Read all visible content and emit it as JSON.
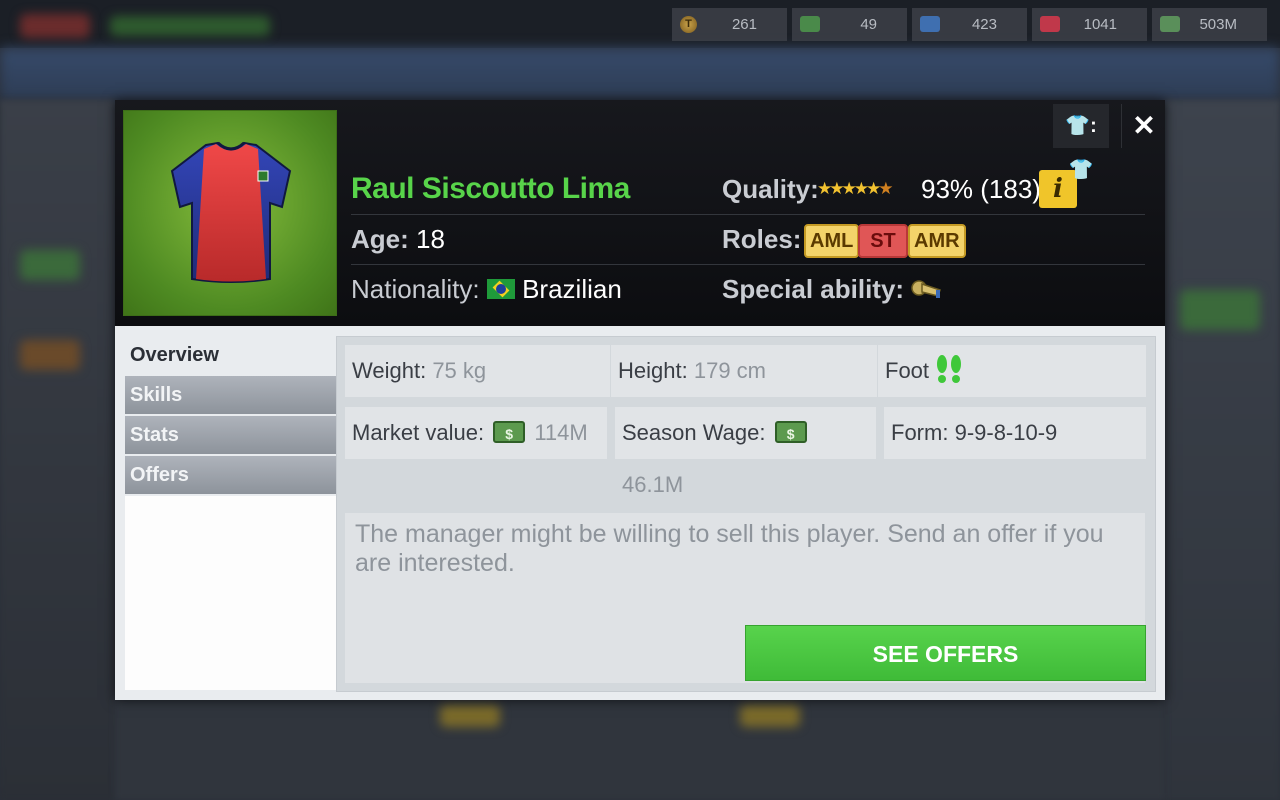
{
  "currencies": [
    {
      "icon": "token-icon",
      "glyph": "T",
      "value": "261"
    },
    {
      "icon": "cash-stack-icon",
      "value": "49"
    },
    {
      "icon": "energy-icon",
      "value": "423"
    },
    {
      "icon": "medical-icon",
      "value": "1041"
    },
    {
      "icon": "money-icon",
      "value": "503M"
    }
  ],
  "header": {
    "switch_label": "👕:👕",
    "close_label": "✕"
  },
  "player": {
    "name": "Raul Siscoutto Lima",
    "age_label": "Age:",
    "age": "18",
    "nationality_label": "Nationality:",
    "nationality": "Brazilian",
    "quality_label": "Quality:",
    "stars": "★★★★★",
    "quality_value": "93% (183)",
    "info_label": "i",
    "roles_label": "Roles:",
    "roles": [
      "AML",
      "ST",
      "AMR"
    ],
    "special_label": "Special ability:"
  },
  "tabs": [
    "Overview",
    "Skills",
    "Stats",
    "Offers"
  ],
  "overview": {
    "weight_label": "Weight:",
    "weight": "75 kg",
    "height_label": "Height:",
    "height": "179 cm",
    "foot_label": "Foot",
    "market_label": "Market value:",
    "market_value": "114M",
    "wage_label": "Season Wage:",
    "wage_value": "46.1M",
    "form_label": "Form:",
    "form_value": "9-9-8-10-9",
    "message": "The manager might be willing to sell this player. Send an offer if you are interested.",
    "button_label": "SEE OFFERS"
  },
  "colors": {
    "name": "#58d44a",
    "button": "#4ac742",
    "info": "#f0c52a",
    "role_yellow": "#f3d36a",
    "role_red": "#e05656"
  }
}
